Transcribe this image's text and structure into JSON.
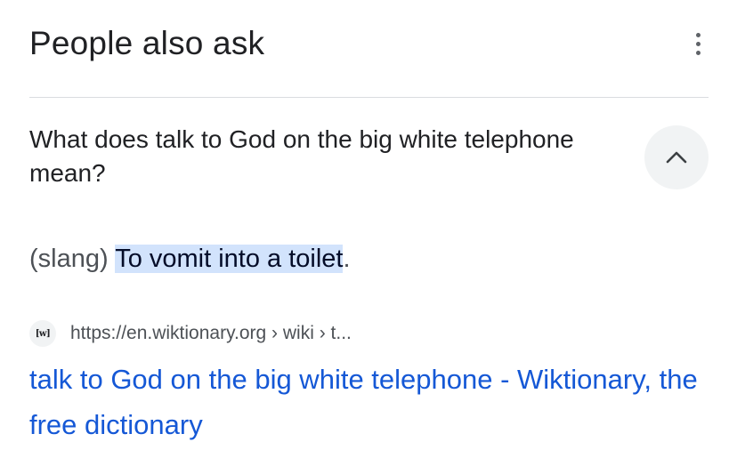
{
  "header": {
    "title": "People also ask",
    "more_icon": "more-vertical-icon"
  },
  "question": {
    "text": "What does talk to God on the big white telephone mean?",
    "toggle_icon": "chevron-up-icon",
    "expanded": true
  },
  "answer": {
    "prefix": "(slang) ",
    "highlighted": "To vomit into a toilet",
    "suffix": "."
  },
  "source": {
    "favicon_text": "[w]",
    "url": "https://en.wiktionary.org › wiki › t..."
  },
  "result": {
    "title": "talk to God on the big white telephone - Wiktionary, the free dictionary"
  },
  "colors": {
    "link": "#1558d6",
    "highlight": "#d2e3fc",
    "button_bg": "#f1f3f4",
    "divider": "#dadce0"
  }
}
